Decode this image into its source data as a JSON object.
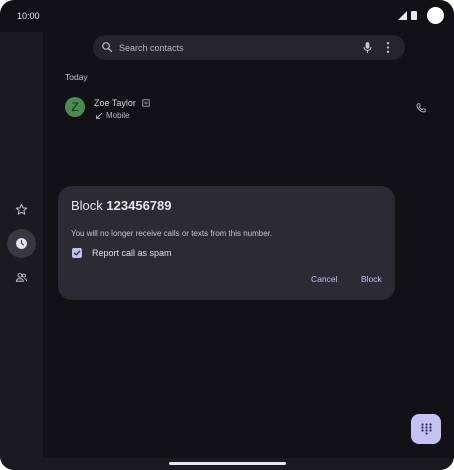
{
  "status_bar": {
    "time": "10:00",
    "icons": [
      "signal-icon",
      "battery-icon",
      "camera-cutout"
    ]
  },
  "nav_rail": {
    "items": [
      {
        "icon": "star-icon",
        "active": false
      },
      {
        "icon": "clock-icon",
        "active": true
      },
      {
        "icon": "people-icon",
        "active": false
      }
    ]
  },
  "search": {
    "placeholder": "Search contacts",
    "icons": [
      "search-icon",
      "mic-icon",
      "more-vert-icon"
    ]
  },
  "call_log": {
    "section_header": "Today",
    "items": [
      {
        "avatar_letter": "Z",
        "avatar_color": "#4c8a54",
        "name": "Zoe Taylor",
        "call_type": "Mobile",
        "direction_icon": "incoming-call-icon",
        "action_icon": "phone-icon"
      }
    ]
  },
  "dialog": {
    "title_prefix": "Block",
    "title_number": "123456789",
    "body": "You will no longer receive calls or texts from this number.",
    "checkbox_label": "Report call as spam",
    "checkbox_checked": true,
    "cancel_label": "Cancel",
    "block_label": "Block"
  },
  "fab": {
    "icon": "dialpad-icon"
  },
  "colors": {
    "background": "#121116",
    "surface": "#2c2b33",
    "accent": "#c3c2f2",
    "text_primary": "#e6e4ee"
  }
}
